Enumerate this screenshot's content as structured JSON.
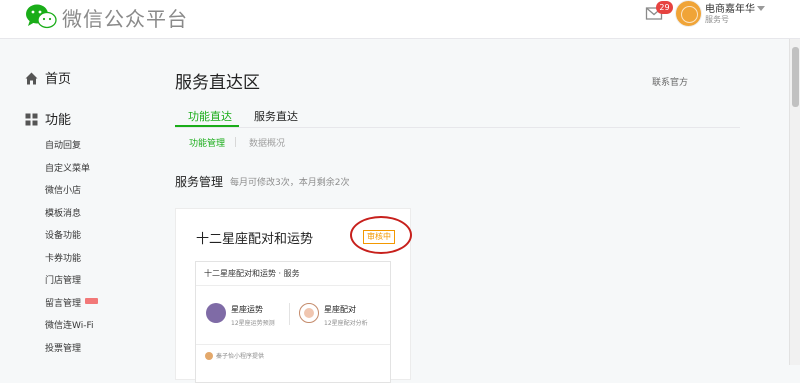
{
  "header": {
    "logo_text": "微信公众平台",
    "mail_count": "29",
    "account_name": "电商嘉年华",
    "account_type": "服务号"
  },
  "sidebar": {
    "home_label": "首页",
    "function_label": "功能",
    "items": [
      {
        "label": "自动回复"
      },
      {
        "label": "自定义菜单"
      },
      {
        "label": "微信小店"
      },
      {
        "label": "模板消息"
      },
      {
        "label": "设备功能"
      },
      {
        "label": "卡券功能"
      },
      {
        "label": "门店管理"
      },
      {
        "label": "留言管理",
        "new": true
      },
      {
        "label": "微信连Wi-Fi"
      },
      {
        "label": "投票管理"
      }
    ]
  },
  "main": {
    "title": "服务直达区",
    "right_link": "联系官方",
    "tabs": [
      {
        "label": "功能直达",
        "active": true
      },
      {
        "label": "服务直达",
        "active": false
      }
    ],
    "subtabs": [
      {
        "label": "功能管理",
        "active": true
      },
      {
        "label": "数据概况",
        "active": false
      }
    ],
    "section_title": "服务管理",
    "section_desc": "每月可修改3次，本月剩余2次",
    "card": {
      "title": "十二星座配对和运势",
      "status": "审核中",
      "inner_title": "十二星座配对和运势 · 服务",
      "services": [
        {
          "name": "星座运势",
          "desc": "12星座运势预测",
          "icon": "horoscope-icon"
        },
        {
          "name": "星座配对",
          "desc": "12星座配对分析",
          "icon": "match-icon"
        }
      ],
      "provider": "秦子怡小程序提供"
    }
  },
  "colors": {
    "accent_green": "#1aad19",
    "status_orange": "#f39800",
    "annotation_red": "#c7201c",
    "badge_red": "#e64340"
  }
}
